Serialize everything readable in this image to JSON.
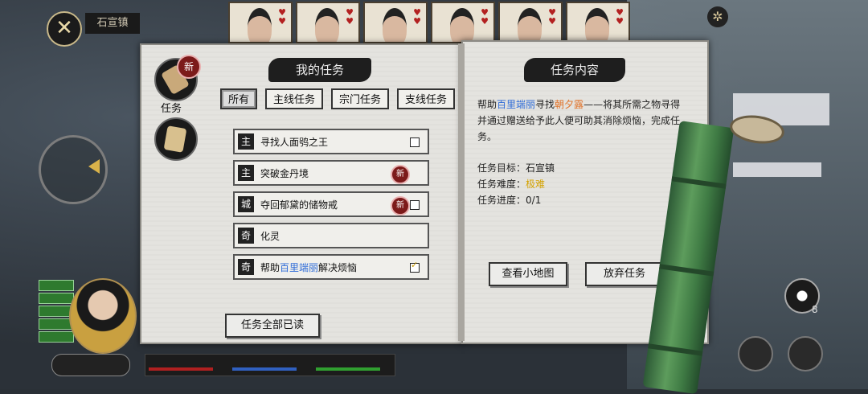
{
  "header": {
    "location": "石宣镇"
  },
  "side_tabs": {
    "quest_label": "任务",
    "new_badge": "新"
  },
  "quest_panel": {
    "title": "我的任务",
    "filters": [
      "所有",
      "主线任务",
      "宗门任务",
      "支线任务"
    ],
    "quests": [
      {
        "tag": "主",
        "name": "寻找人面鸮之王",
        "badge": "",
        "checked": false
      },
      {
        "tag": "主",
        "name": "突破金丹境",
        "badge": "新",
        "checked": null
      },
      {
        "tag": "城",
        "name": "夺回郁黛的储物戒",
        "badge": "新",
        "checked": false
      },
      {
        "tag": "奇",
        "name": "化灵",
        "badge": "",
        "checked": null
      },
      {
        "tag": "奇",
        "name_pre": "帮助",
        "name_hl": "百里端丽",
        "name_post": "解决烦恼",
        "badge": "",
        "checked": true
      }
    ],
    "mark_all_read": "任务全部已读"
  },
  "detail_panel": {
    "title": "任务内容",
    "desc_pre": "帮助",
    "desc_npc1": "百里端丽",
    "desc_mid": "寻找",
    "desc_npc2": "朝夕露",
    "desc_post": "——将其所需之物寻得并通过赠送给予此人便可助其消除烦恼，完成任务。",
    "target_label": "任务目标：",
    "target_value": "石宣镇",
    "difficulty_label": "任务难度：",
    "difficulty_value": "极难",
    "progress_label": "任务进度：",
    "progress_value": "0/1",
    "map_button": "查看小地图",
    "abandon_button": "放弃任务"
  },
  "hud": {
    "taiji_count": "8"
  },
  "colors": {
    "highlight_blue": "#2d6bd8",
    "highlight_orange": "#e0732a",
    "difficulty_yellow": "#d4a200",
    "badge_red": "#7c1a1a"
  }
}
